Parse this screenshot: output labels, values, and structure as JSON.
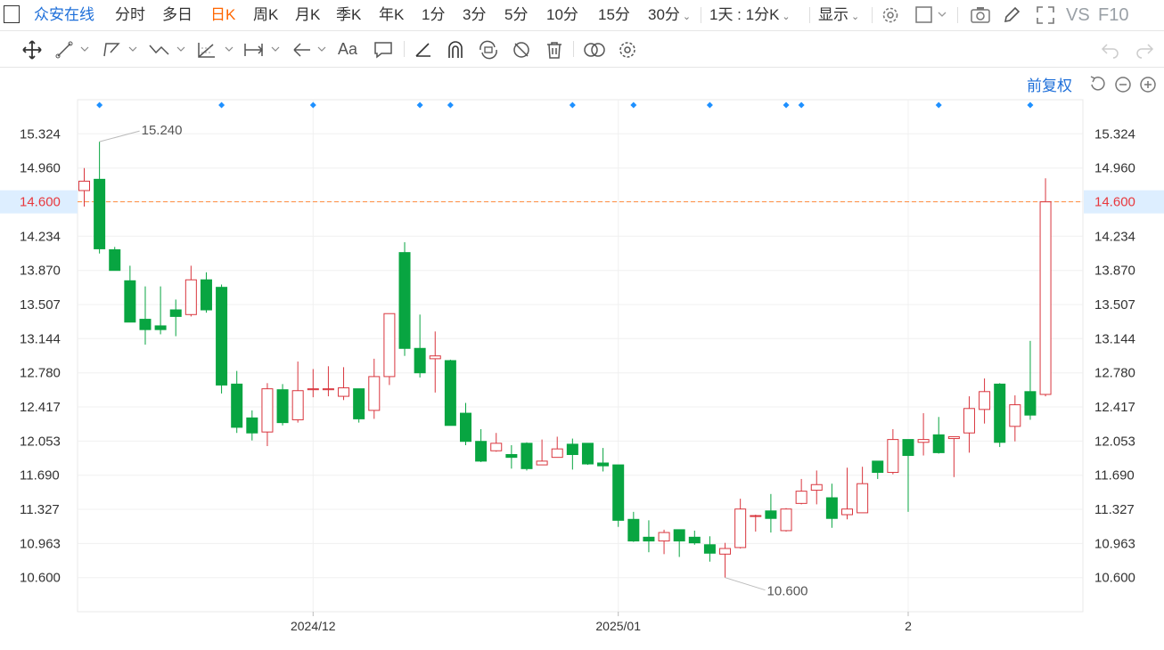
{
  "toolbar": {
    "brand": "众安在线",
    "periods": [
      "分时",
      "多日",
      "日K",
      "周K",
      "月K",
      "季K",
      "年K",
      "1分",
      "3分",
      "5分",
      "10分",
      "15分",
      "30分"
    ],
    "active_period": "日K",
    "range_select": "1天 : 1分K",
    "display_label": "显示",
    "vs_label": "VS",
    "f10_label": "F10"
  },
  "drawing_toolbar": {
    "text_tool_label": "Aa",
    "tools": [
      "move-icon",
      "line-icon",
      "polyline-icon",
      "wave-icon",
      "fib-icon",
      "measure-icon",
      "arrow-icon",
      "text-icon",
      "comment-icon",
      "ruler-icon",
      "magnet-icon",
      "lock-icon",
      "hide-icon",
      "delete-icon",
      "compare-icon",
      "settings-icon",
      "undo-icon",
      "redo-icon"
    ]
  },
  "chart_header": {
    "adjust_label": "前复权"
  },
  "chart_data": {
    "type": "candlestick",
    "ylim": [
      10.237,
      15.687
    ],
    "y_ticks": [
      "15.324",
      "14.960",
      "14.600",
      "14.234",
      "13.870",
      "13.507",
      "13.144",
      "12.780",
      "12.417",
      "12.053",
      "11.690",
      "11.327",
      "10.963",
      "10.600"
    ],
    "x_labels": [
      {
        "label": "2024/12",
        "index": 15
      },
      {
        "label": "2025/01",
        "index": 35
      },
      {
        "label": "2",
        "index": 54
      }
    ],
    "current_price": "14.600",
    "max_label": "15.240",
    "min_label": "10.600",
    "event_marker_indices": [
      1,
      9,
      15,
      22,
      24,
      32,
      36,
      41,
      46,
      47,
      56,
      62
    ],
    "colors": {
      "up": "#d9363e",
      "down": "#08a541",
      "price_line": "#ff8a3c",
      "marker": "#1e90ff",
      "grid": "#f0f0f0"
    },
    "candles": [
      {
        "o": 14.72,
        "h": 14.96,
        "l": 14.55,
        "c": 14.82
      },
      {
        "o": 14.84,
        "h": 15.24,
        "l": 14.05,
        "c": 14.1
      },
      {
        "o": 14.09,
        "h": 14.12,
        "l": 13.88,
        "c": 13.87
      },
      {
        "o": 13.76,
        "h": 13.92,
        "l": 13.52,
        "c": 13.32
      },
      {
        "o": 13.35,
        "h": 13.7,
        "l": 13.08,
        "c": 13.24
      },
      {
        "o": 13.28,
        "h": 13.7,
        "l": 13.19,
        "c": 13.24
      },
      {
        "o": 13.45,
        "h": 13.56,
        "l": 13.17,
        "c": 13.38
      },
      {
        "o": 13.4,
        "h": 13.92,
        "l": 13.38,
        "c": 13.77
      },
      {
        "o": 13.77,
        "h": 13.85,
        "l": 13.42,
        "c": 13.45
      },
      {
        "o": 13.69,
        "h": 13.72,
        "l": 12.56,
        "c": 12.65
      },
      {
        "o": 12.66,
        "h": 12.8,
        "l": 12.14,
        "c": 12.2
      },
      {
        "o": 12.3,
        "h": 12.38,
        "l": 12.06,
        "c": 12.14
      },
      {
        "o": 12.15,
        "h": 12.67,
        "l": 12.0,
        "c": 12.61
      },
      {
        "o": 12.6,
        "h": 12.66,
        "l": 12.22,
        "c": 12.25
      },
      {
        "o": 12.28,
        "h": 12.9,
        "l": 12.25,
        "c": 12.59
      },
      {
        "o": 12.6,
        "h": 12.82,
        "l": 12.52,
        "c": 12.61
      },
      {
        "o": 12.6,
        "h": 12.85,
        "l": 12.53,
        "c": 12.61
      },
      {
        "o": 12.53,
        "h": 12.84,
        "l": 12.49,
        "c": 12.62
      },
      {
        "o": 12.61,
        "h": 12.61,
        "l": 12.25,
        "c": 12.29
      },
      {
        "o": 12.38,
        "h": 12.93,
        "l": 12.29,
        "c": 12.74
      },
      {
        "o": 12.74,
        "h": 13.41,
        "l": 12.65,
        "c": 13.41
      },
      {
        "o": 14.06,
        "h": 14.17,
        "l": 12.96,
        "c": 13.04
      },
      {
        "o": 13.04,
        "h": 13.4,
        "l": 12.73,
        "c": 12.78
      },
      {
        "o": 12.93,
        "h": 13.22,
        "l": 12.57,
        "c": 12.96
      },
      {
        "o": 12.91,
        "h": 12.92,
        "l": 12.22,
        "c": 12.22
      },
      {
        "o": 12.35,
        "h": 12.46,
        "l": 12.01,
        "c": 12.05
      },
      {
        "o": 12.05,
        "h": 12.18,
        "l": 11.83,
        "c": 11.84
      },
      {
        "o": 11.95,
        "h": 12.14,
        "l": 11.94,
        "c": 12.03
      },
      {
        "o": 11.91,
        "h": 12.01,
        "l": 11.76,
        "c": 11.88
      },
      {
        "o": 12.03,
        "h": 12.04,
        "l": 11.74,
        "c": 11.76
      },
      {
        "o": 11.8,
        "h": 12.07,
        "l": 11.8,
        "c": 11.84
      },
      {
        "o": 11.88,
        "h": 12.1,
        "l": 11.88,
        "c": 11.97
      },
      {
        "o": 12.02,
        "h": 12.08,
        "l": 11.75,
        "c": 11.91
      },
      {
        "o": 12.03,
        "h": 12.03,
        "l": 11.8,
        "c": 11.81
      },
      {
        "o": 11.82,
        "h": 11.98,
        "l": 11.73,
        "c": 11.79
      },
      {
        "o": 11.8,
        "h": 11.8,
        "l": 11.14,
        "c": 11.21
      },
      {
        "o": 11.22,
        "h": 11.3,
        "l": 10.98,
        "c": 10.99
      },
      {
        "o": 11.03,
        "h": 11.21,
        "l": 10.87,
        "c": 10.99
      },
      {
        "o": 10.99,
        "h": 11.11,
        "l": 10.85,
        "c": 11.08
      },
      {
        "o": 11.11,
        "h": 11.11,
        "l": 10.82,
        "c": 10.99
      },
      {
        "o": 11.03,
        "h": 11.1,
        "l": 10.95,
        "c": 10.97
      },
      {
        "o": 10.95,
        "h": 11.04,
        "l": 10.77,
        "c": 10.86
      },
      {
        "o": 10.85,
        "h": 10.97,
        "l": 10.6,
        "c": 10.91
      },
      {
        "o": 10.92,
        "h": 11.44,
        "l": 10.91,
        "c": 11.33
      },
      {
        "o": 11.26,
        "h": 11.27,
        "l": 11.09,
        "c": 11.26
      },
      {
        "o": 11.31,
        "h": 11.49,
        "l": 11.08,
        "c": 11.23
      },
      {
        "o": 11.1,
        "h": 11.34,
        "l": 11.09,
        "c": 11.33
      },
      {
        "o": 11.39,
        "h": 11.65,
        "l": 11.38,
        "c": 11.52
      },
      {
        "o": 11.53,
        "h": 11.74,
        "l": 11.38,
        "c": 11.59
      },
      {
        "o": 11.45,
        "h": 11.6,
        "l": 11.13,
        "c": 11.23
      },
      {
        "o": 11.27,
        "h": 11.77,
        "l": 11.22,
        "c": 11.33
      },
      {
        "o": 11.29,
        "h": 11.78,
        "l": 11.29,
        "c": 11.6
      },
      {
        "o": 11.84,
        "h": 11.84,
        "l": 11.65,
        "c": 11.72
      },
      {
        "o": 11.72,
        "h": 12.18,
        "l": 11.7,
        "c": 12.07
      },
      {
        "o": 12.07,
        "h": 12.07,
        "l": 11.3,
        "c": 11.9
      },
      {
        "o": 12.04,
        "h": 12.35,
        "l": 11.9,
        "c": 12.07
      },
      {
        "o": 12.12,
        "h": 12.31,
        "l": 11.92,
        "c": 11.93
      },
      {
        "o": 12.08,
        "h": 12.1,
        "l": 11.67,
        "c": 12.1
      },
      {
        "o": 12.14,
        "h": 12.53,
        "l": 11.93,
        "c": 12.4
      },
      {
        "o": 12.39,
        "h": 12.72,
        "l": 12.24,
        "c": 12.58
      },
      {
        "o": 12.66,
        "h": 12.67,
        "l": 11.99,
        "c": 12.04
      },
      {
        "o": 12.21,
        "h": 12.54,
        "l": 12.05,
        "c": 12.44
      },
      {
        "o": 12.58,
        "h": 13.12,
        "l": 12.28,
        "c": 12.33
      },
      {
        "o": 12.55,
        "h": 14.85,
        "l": 12.53,
        "c": 14.6
      }
    ]
  }
}
